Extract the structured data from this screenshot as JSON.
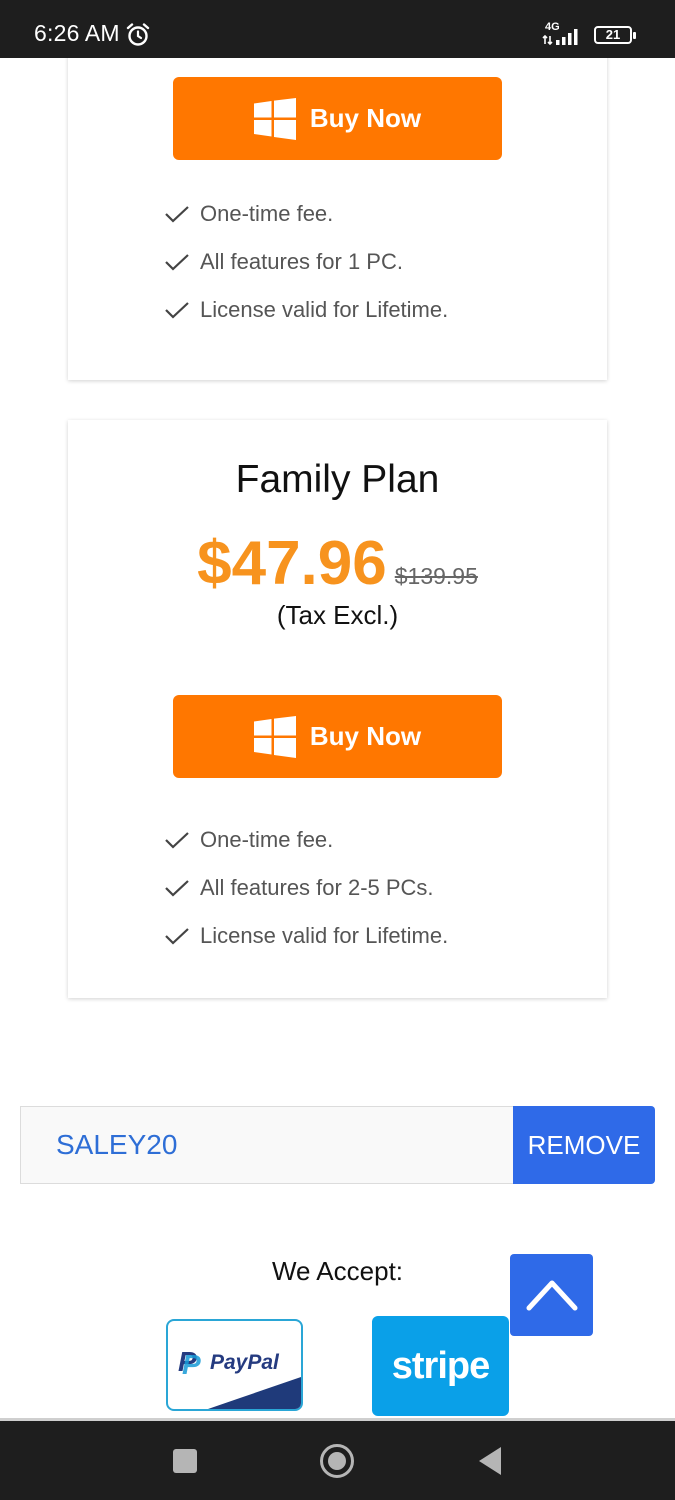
{
  "status_bar": {
    "time": "6:26 AM",
    "network": "4G",
    "battery": "21"
  },
  "top_card": {
    "buy_label": "Buy Now",
    "features": [
      "One-time fee.",
      "All features for 1 PC.",
      "License valid for Lifetime."
    ]
  },
  "family_card": {
    "title": "Family Plan",
    "price": "$47.96",
    "old_price": "$139.95",
    "tax_note": "(Tax Excl.)",
    "buy_label": "Buy Now",
    "features": [
      "One-time fee.",
      "All features for 2-5 PCs.",
      "License valid for Lifetime."
    ]
  },
  "coupon": {
    "code": "SALEY20",
    "remove_label": "REMOVE"
  },
  "payments": {
    "title": "We Accept:",
    "paypal_label": "PayPal",
    "stripe_label": "stripe"
  },
  "colors": {
    "buy_button": "#ff7700",
    "price": "#f7931e",
    "accent_blue": "#2f6ae8",
    "stripe": "#0aa0e8"
  },
  "icons": {
    "alarm": "alarm-icon",
    "windows": "windows-icon",
    "check": "check-icon",
    "scroll_top": "chevron-up-icon",
    "nav_recent": "square-icon",
    "nav_home": "circle-icon",
    "nav_back": "triangle-back-icon"
  }
}
